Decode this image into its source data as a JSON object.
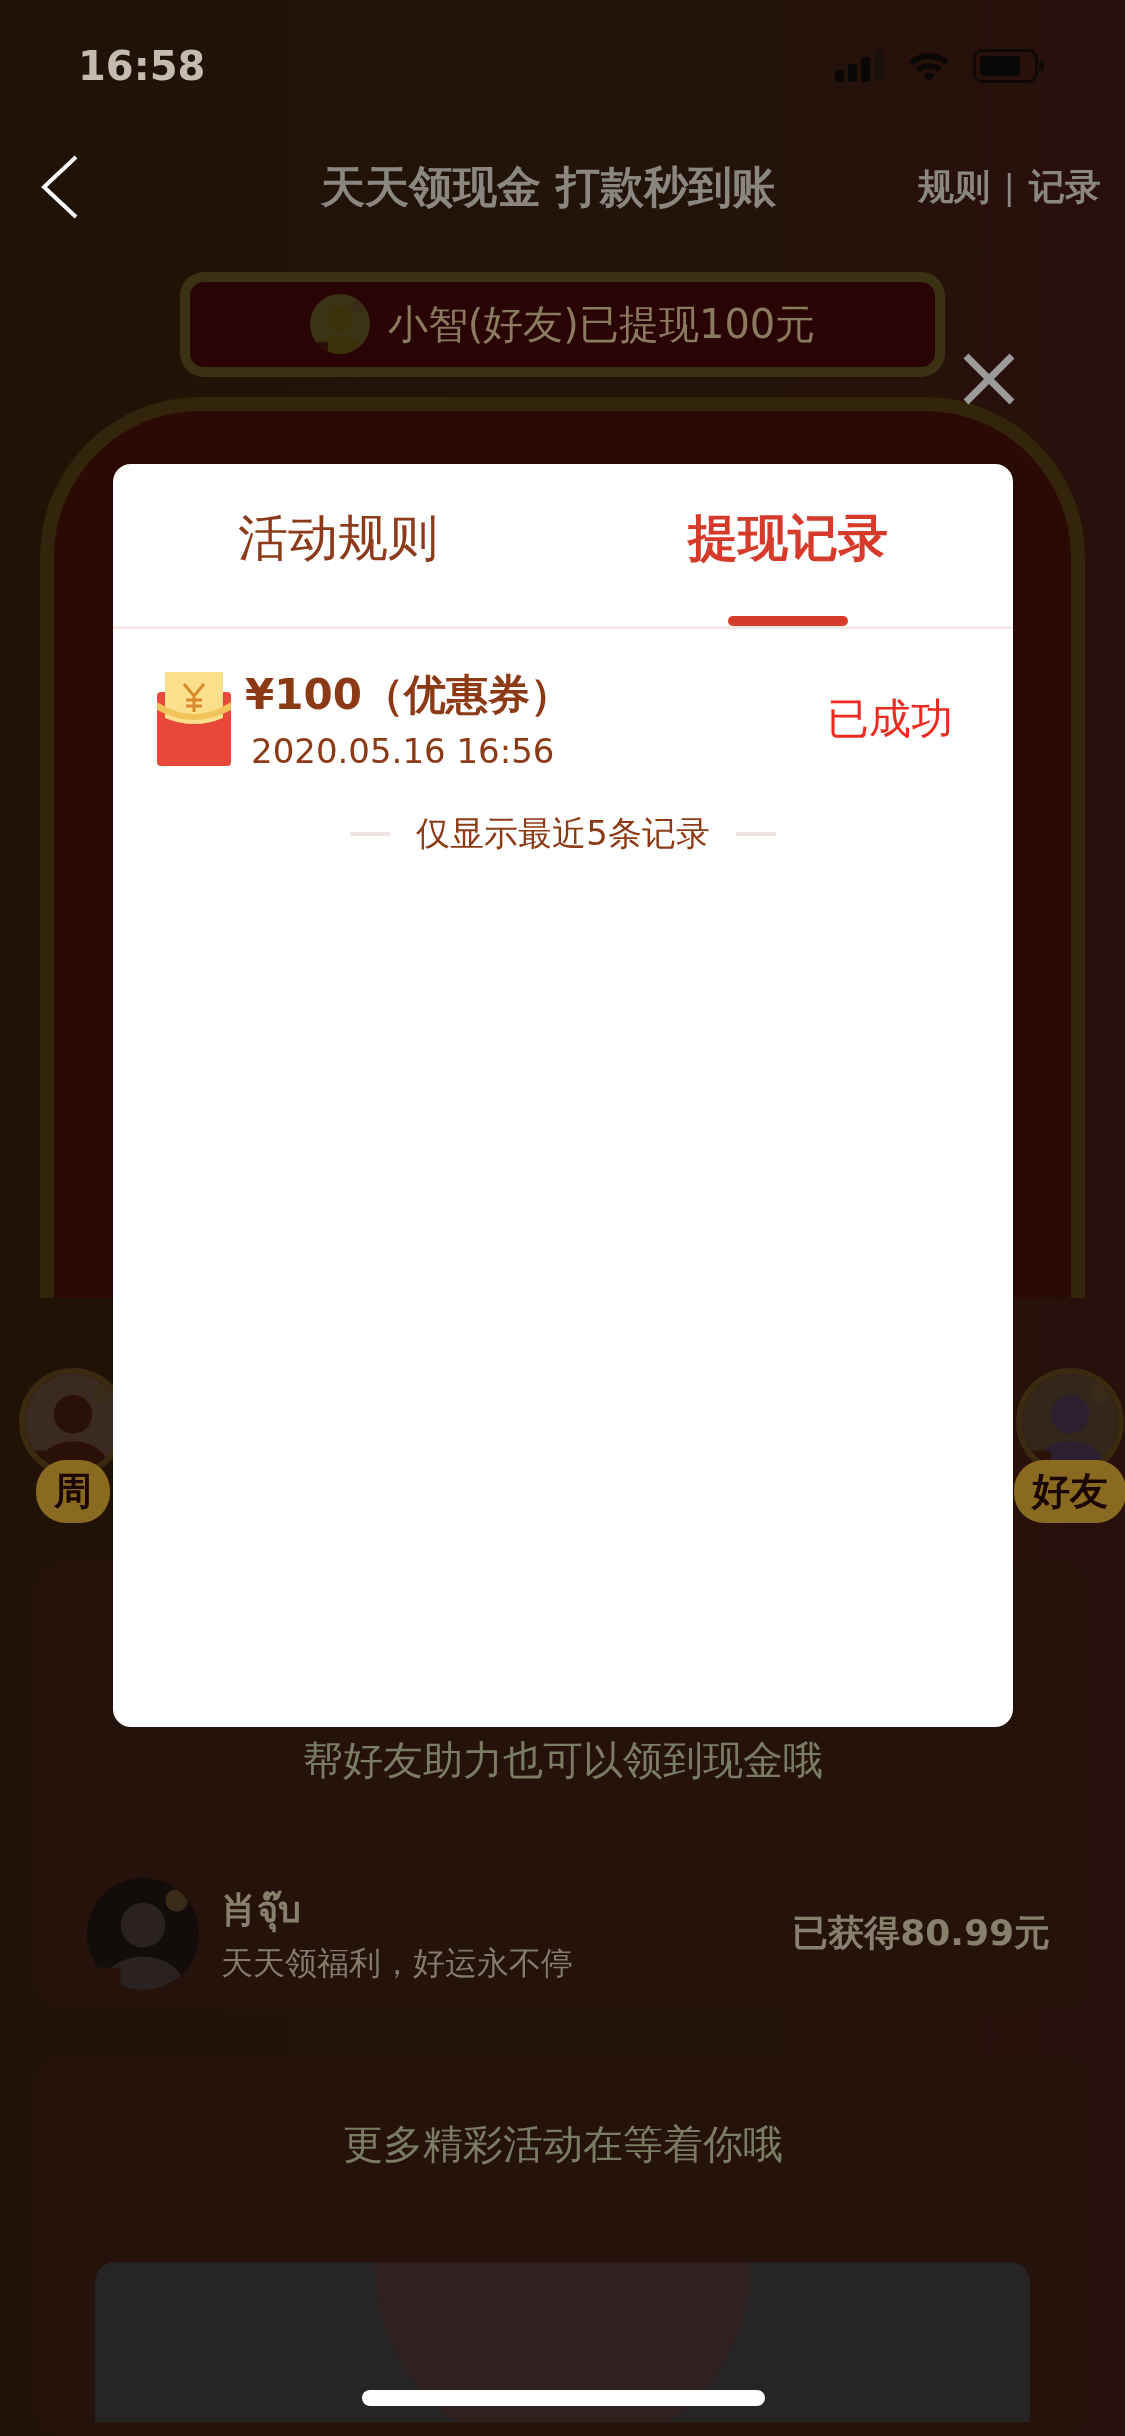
{
  "status_bar": {
    "time": "16:58"
  },
  "nav": {
    "title": "天天领现金 打款秒到账",
    "links": [
      "规则",
      "记录"
    ],
    "separator": "|"
  },
  "ticker": {
    "text": "小智(好友)已提现100元"
  },
  "helpers": [
    {
      "label": "周"
    },
    {
      "label": "好友"
    }
  ],
  "help_card": {
    "title": "帮好友助力也可以领到现金哦",
    "friend": {
      "name": "肖จุ๊บ",
      "motto": "天天领福利，好运永不停",
      "earned": "已获得80.99元"
    }
  },
  "more_card": {
    "title": "更多精彩活动在等着你哦"
  },
  "dialog": {
    "tabs": [
      {
        "label": "活动规则",
        "selected": false
      },
      {
        "label": "提现记录",
        "selected": true
      }
    ],
    "records": [
      {
        "amount": "¥100（优惠券）",
        "time": "2020.05.16 16:56",
        "status": "已成功"
      }
    ],
    "note": "仅显示最近5条记录"
  }
}
